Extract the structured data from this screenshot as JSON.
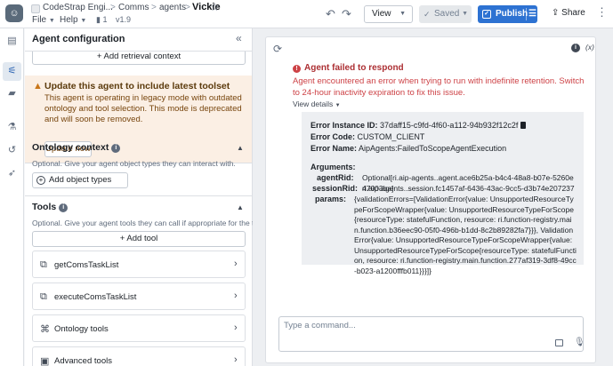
{
  "header": {
    "project": "CodeStrap Engi...",
    "breadcrumb": [
      "Comms",
      "agents"
    ],
    "current": "Vickie",
    "menus": [
      "File",
      "Help"
    ],
    "file_count": "1",
    "version": "v1.9",
    "view_label": "View",
    "saved_label": "Saved",
    "publish_label": "Publish",
    "share_label": "Share"
  },
  "config": {
    "title": "Agent configuration",
    "add_retrieval": "Add retrieval context",
    "callout": {
      "title": "Update this agent to include latest toolset",
      "body": "This agent is operating in legacy mode with outdated ontology and tool selection. This mode is deprecated and will soon be removed.",
      "button": "Update now"
    },
    "ontology": {
      "title": "Ontology context",
      "desc": "Optional. Give your agent object types they can interact with.",
      "button": "Add object types"
    },
    "tools": {
      "title": "Tools",
      "desc": "Optional. Give your agent tools they can call if appropriate for the task at hand.",
      "add_button": "Add tool",
      "items": [
        {
          "label": "getComsTaskList"
        },
        {
          "label": "executeComsTaskList"
        },
        {
          "label": "Ontology tools"
        },
        {
          "label": "Advanced tools"
        }
      ]
    }
  },
  "chat": {
    "fx_label": "(x)",
    "error_title": "Agent failed to respond",
    "error_message": "Agent encountered an error when trying to run with indefinite retention. Switch to 24-hour inactivity expiration to fix this issue.",
    "view_details": "View details",
    "details": {
      "instance_label": "Error Instance ID:",
      "instance_value": "37daff15-c9fd-4f60-a112-94b932f12c2f",
      "code_label": "Error Code:",
      "code_value": "CUSTOM_CLIENT",
      "name_label": "Error Name:",
      "name_value": "AipAgents:FailedToScopeAgentExecution",
      "args_label": "Arguments:",
      "agent_rid_label": "agentRid:",
      "agent_rid_value": "Optional[ri.aip-agents..agent.ace6b25a-b4c4-48a8-b07e-5260e47003ba]",
      "session_rid_label": "sessionRid:",
      "session_rid_value": "ri.aip-agents..session.fc1457af-6436-43ac-9cc5-d3b74e207237",
      "params_label": "params:",
      "params_value": "{validationErrors=[ValidationError{value: UnsupportedResourceTypeForScopeWrapper{value: UnsupportedResourceTypeForScope{resourceType: statefulFunction, resource: ri.function-registry.main.function.b36eec90-05f0-496b-b1dd-8c2b89282fa7}}}, ValidationError{value: UnsupportedResourceTypeForScopeWrapper{value: UnsupportedResourceTypeForScope{resourceType: statefulFunction, resource: ri.function-registry.main.function.277af319-3df8-49cc-b023-a1200fffb011}}}]}"
    },
    "command_placeholder": "Type a command..."
  }
}
